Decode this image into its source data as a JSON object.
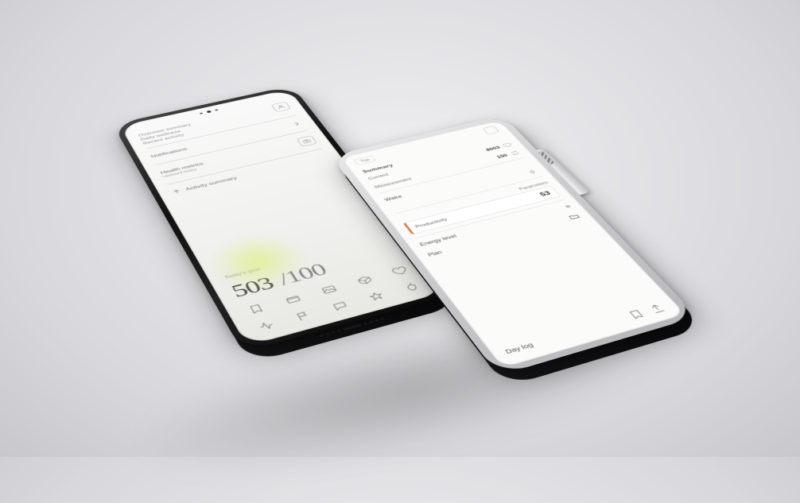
{
  "left": {
    "header_lines": [
      "Overview summary",
      "Daily wellness",
      "Recent activity"
    ],
    "list": [
      {
        "label": "Notifications"
      },
      {
        "label": "Health metrics",
        "sub": "Updated today"
      },
      {
        "label": "Activity summary"
      }
    ],
    "big_caption": "Today's goal",
    "big_a": "503",
    "big_b": "/100"
  },
  "right": {
    "top_label": "Top",
    "heading": "Summary",
    "rows": [
      {
        "label": "Current",
        "value": "8003"
      },
      {
        "label": "Measurement",
        "value": "150"
      }
    ],
    "sub_heading": "Wake",
    "highlight_label": "Productivity",
    "highlight_value": "53",
    "secondary_label": "Parameters",
    "list2": [
      {
        "label": "Energy level"
      },
      {
        "label": "Plan"
      }
    ],
    "bottom_label": "Day log"
  }
}
